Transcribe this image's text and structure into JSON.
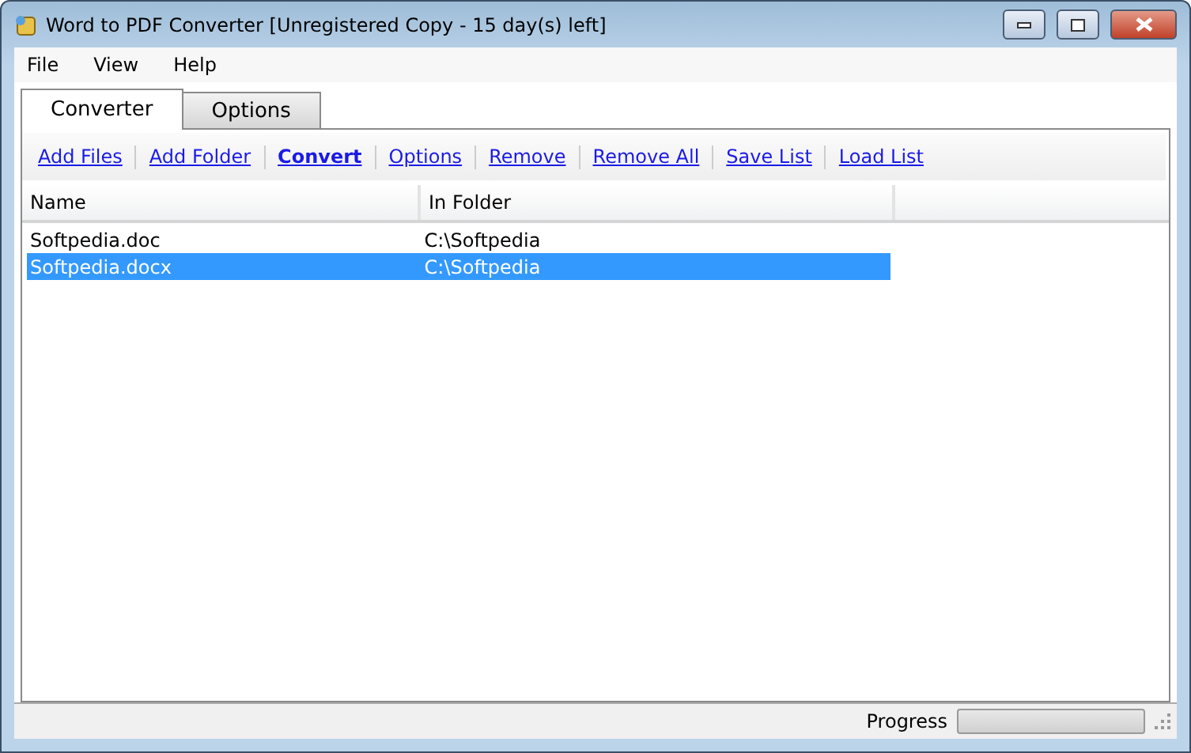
{
  "window": {
    "title": "Word to PDF Converter [Unregistered Copy - 15 day(s) left]"
  },
  "menu": [
    "File",
    "View",
    "Help"
  ],
  "tabs": [
    {
      "label": "Converter",
      "selected": true
    },
    {
      "label": "Options",
      "selected": false
    }
  ],
  "toolbar": [
    {
      "label": "Add Files",
      "bold": false
    },
    {
      "label": "Add Folder",
      "bold": false
    },
    {
      "label": "Convert",
      "bold": true
    },
    {
      "label": "Options",
      "bold": false
    },
    {
      "label": "Remove",
      "bold": false
    },
    {
      "label": "Remove All",
      "bold": false
    },
    {
      "label": "Save List",
      "bold": false
    },
    {
      "label": "Load List",
      "bold": false
    }
  ],
  "table": {
    "columns": [
      "Name",
      "In Folder"
    ],
    "rows": [
      {
        "cells": [
          "Softpedia.doc",
          "C:\\Softpedia"
        ],
        "selected": false
      },
      {
        "cells": [
          "Softpedia.docx",
          "C:\\Softpedia"
        ],
        "selected": true
      }
    ]
  },
  "status_bar": {
    "label": "Progress",
    "level": 0
  }
}
